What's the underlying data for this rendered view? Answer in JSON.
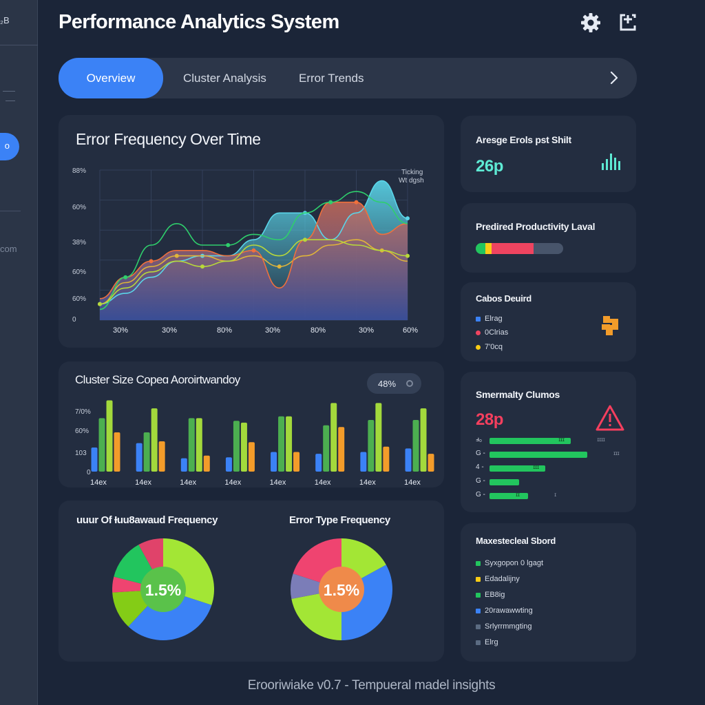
{
  "app": {
    "title": "Performance Analytics System",
    "sidebar_logo": "₂B",
    "sidebar_active": "o",
    "sidebar_text": "com"
  },
  "topbar": {
    "settings_icon": "gear-icon",
    "export_icon": "export-icon"
  },
  "tabs": {
    "items": [
      {
        "label": "Overview",
        "active": true
      },
      {
        "label": "Cluster Analysis",
        "active": false
      },
      {
        "label": "Error Trends",
        "active": false
      }
    ],
    "next_icon": "chevron-right-icon"
  },
  "error_frequency": {
    "title": "Error Frequency Over Time",
    "annotation_1": "Ticking",
    "annotation_2": "Wt dgsh",
    "chart_data": {
      "type": "area",
      "y_ticks": [
        "88%",
        "60%",
        "38%",
        "60%",
        "60%",
        "0"
      ],
      "x_ticks": [
        "30%",
        "30%",
        "80%",
        "30%",
        "80%",
        "30%",
        "60%"
      ],
      "x": [
        0,
        1,
        2,
        3,
        4,
        5,
        6,
        7,
        8,
        9,
        10,
        11,
        12
      ],
      "series": [
        {
          "color": "#5ad5e9",
          "values": [
            3,
            5,
            8,
            11,
            12,
            12,
            15,
            20,
            20,
            15,
            20,
            26,
            19
          ]
        },
        {
          "color": "#e0b43a",
          "values": [
            3,
            7,
            10,
            12,
            12,
            11,
            12,
            10,
            12,
            14,
            15,
            13,
            11
          ]
        },
        {
          "color": "#f0703c",
          "values": [
            4,
            8,
            11,
            13,
            13,
            12,
            13,
            6,
            15,
            22,
            22,
            16,
            18
          ]
        },
        {
          "color": "#2fcf6c",
          "values": [
            2,
            8,
            14,
            18,
            14,
            14,
            16,
            15,
            20,
            22,
            24,
            22,
            18
          ]
        },
        {
          "color": "#b8d83a",
          "values": [
            3,
            6,
            9,
            11,
            10,
            11,
            14,
            12,
            15,
            15,
            14,
            13,
            12
          ]
        }
      ]
    }
  },
  "cluster_size": {
    "title": "Cluster Size Copeɑ Aoroirtwandoy",
    "badge": "48%",
    "chart_data": {
      "type": "bar",
      "y_ticks": [
        "7/0%",
        "60%",
        "103",
        "0"
      ],
      "categories": [
        "14ex",
        "14ex",
        "14ex",
        "14ex",
        "14ex",
        "14ex",
        "14ex",
        "14ex"
      ],
      "series": [
        {
          "color": "#3b82f6",
          "values": [
            27,
            32,
            15,
            16,
            22,
            20,
            22,
            26
          ]
        },
        {
          "color": "#4caf50",
          "values": [
            60,
            44,
            60,
            57,
            62,
            52,
            58,
            58
          ]
        },
        {
          "color": "#a3d93c",
          "values": [
            80,
            71,
            60,
            55,
            62,
            77,
            77,
            71
          ]
        },
        {
          "color": "#f39c2a",
          "values": [
            44,
            34,
            18,
            33,
            22,
            50,
            28,
            20
          ]
        }
      ]
    }
  },
  "cluster_freq": {
    "title": "uuur Of Ɨuu8awaud Frequency",
    "center_label": "1.5%",
    "chart_data": {
      "type": "pie",
      "slices": [
        {
          "color": "#a3e635",
          "value": 30
        },
        {
          "color": "#3b82f6",
          "value": 32
        },
        {
          "color": "#84cc16",
          "value": 12
        },
        {
          "color": "#ef4470",
          "value": 5
        },
        {
          "color": "#22c55e",
          "value": 13
        },
        {
          "color": "#e0436a",
          "value": 8
        }
      ]
    }
  },
  "error_type": {
    "title": "Error Type Frequency",
    "center_label": "1.5%",
    "chart_data": {
      "type": "pie",
      "slices": [
        {
          "color": "#a3e635",
          "value": 17
        },
        {
          "color": "#3b82f6",
          "value": 33
        },
        {
          "color": "#a3e635",
          "value": 22
        },
        {
          "color": "#7b7db8",
          "value": 8
        },
        {
          "color": "#ef4470",
          "value": 20
        }
      ]
    }
  },
  "avg_errors": {
    "title": "Aresge Erols pst Shilt",
    "value": "26p",
    "icon": "bar-chart-icon"
  },
  "productivity": {
    "title": "Predired Productivity Laval",
    "segments": [
      {
        "color": "#22c55e",
        "value": 0.11
      },
      {
        "color": "#facc15",
        "value": 0.07
      },
      {
        "color": "#ef4460",
        "value": 0.48
      }
    ]
  },
  "cause": {
    "title": "Cabos Deuird",
    "icon": "puzzle-icon",
    "legend": [
      {
        "color": "#3b82f6",
        "label": "Elrag"
      },
      {
        "color": "#ef4460",
        "label": "0Clrias"
      },
      {
        "color": "#facc15",
        "label": "7'0cq"
      }
    ]
  },
  "summary": {
    "title": "Smermalty Clumos",
    "value": "28p",
    "icon": "warning-icon",
    "rows": [
      {
        "label": "ⅎ₀",
        "value": 0.8,
        "bar_text": "ɪɪɪ",
        "end_text": "ɪɪɪɪ"
      },
      {
        "label": "G -",
        "value": 0.96,
        "bar_text": "",
        "end_text": "ɪɪɪ"
      },
      {
        "label": "4 -",
        "value": 0.55,
        "bar_text": "ɪɪɪ",
        "end_text": ""
      },
      {
        "label": "G -",
        "value": 0.29,
        "bar_text": "",
        "end_text": ""
      },
      {
        "label": "G -",
        "value": 0.38,
        "bar_text": "ɪɪ",
        "end_text": "ɪ"
      }
    ]
  },
  "marketplace": {
    "title": "Maxestecleal Sbord",
    "items": [
      {
        "color": "#22c55e",
        "label": "Syxgopon 0 lgagt"
      },
      {
        "color": "#facc15",
        "label": "Edadalijny"
      },
      {
        "color": "#22c55e",
        "label": "EB8ig"
      },
      {
        "color": "#3b82f6",
        "label": "20rawawwting"
      },
      {
        "color": "#5b6b82",
        "label": "Srlyrrmmgting"
      },
      {
        "color": "#5b6b82",
        "label": "Elrg"
      }
    ]
  },
  "footer": {
    "text": "Erooriwiake v0.7 - Tempueral madel insights"
  }
}
